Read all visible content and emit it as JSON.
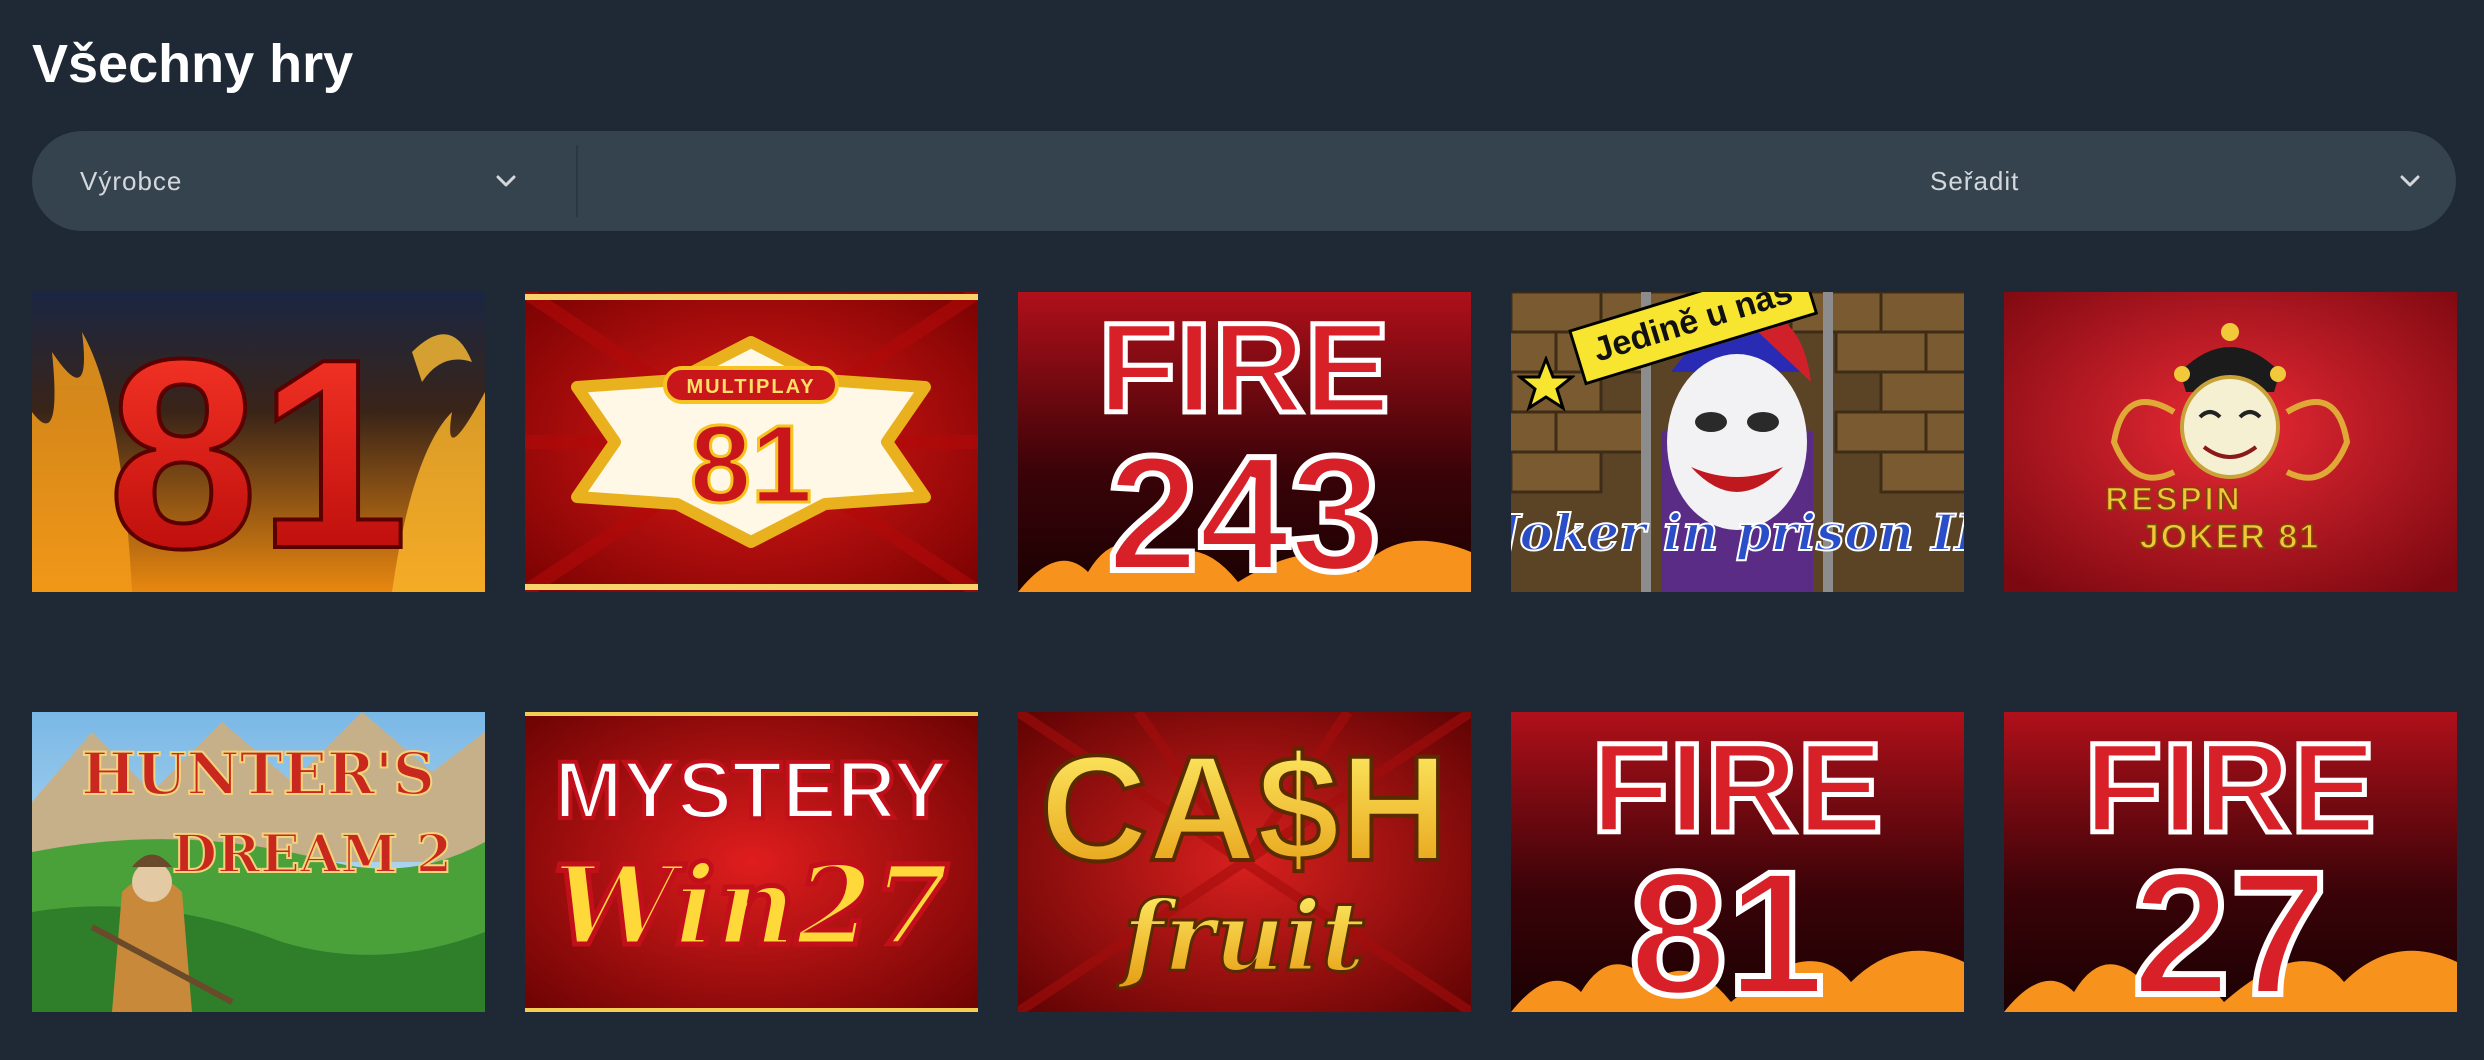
{
  "page": {
    "title": "Všechny hry"
  },
  "filters": {
    "manufacturer_label": "Výrobce",
    "sort_label": "Seřadit"
  },
  "badge": {
    "text": "Jedině u nás"
  },
  "games": [
    {
      "title_line1": "81",
      "title_line2": ""
    },
    {
      "title_line1": "MULTIPLAY",
      "title_line2": "81"
    },
    {
      "title_line1": "FIRE",
      "title_line2": "243"
    },
    {
      "title_line1": "Joker in prison II",
      "title_line2": ""
    },
    {
      "title_line1": "RESPIN",
      "title_line2": "JOKER 81"
    },
    {
      "title_line1": "HUNTER'S",
      "title_line2": "DREAM 2"
    },
    {
      "title_line1": "MYSTERY",
      "title_line2": "Win27"
    },
    {
      "title_line1": "CA$H",
      "title_line2": "fruit"
    },
    {
      "title_line1": "FIRE",
      "title_line2": "81"
    },
    {
      "title_line1": "FIRE",
      "title_line2": "27"
    }
  ],
  "icons": {
    "manufacturer_dropdown": "chevron-down-icon",
    "sort_dropdown": "chevron-down-icon",
    "badge_star": "star-icon"
  },
  "colors": {
    "background": "#1f2935",
    "filter_bar": "#35434f",
    "badge": "#f7e52f"
  }
}
